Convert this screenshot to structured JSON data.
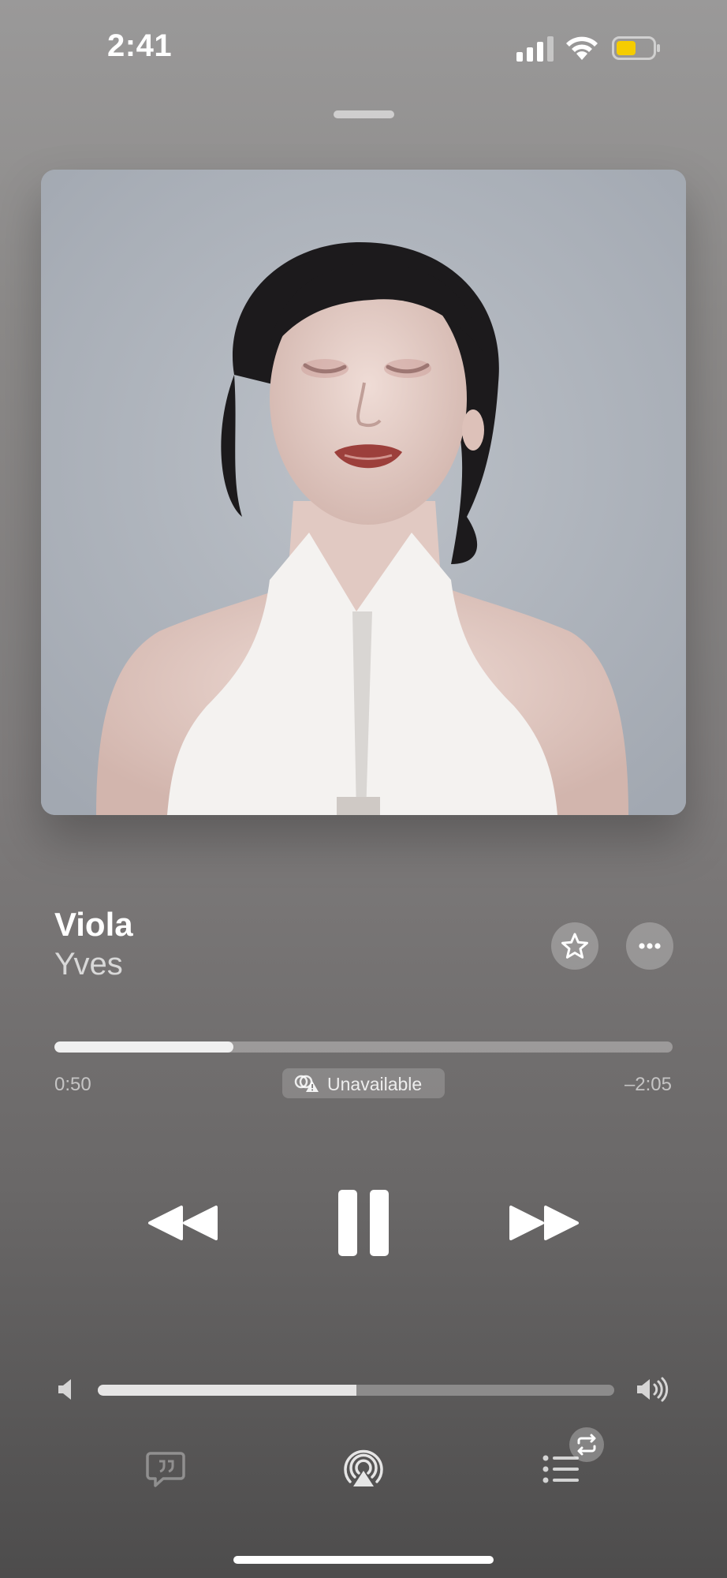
{
  "status_bar": {
    "time": "2:41",
    "icons": [
      "cellular-signal-icon",
      "wifi-icon",
      "battery-icon"
    ],
    "battery_color": "#f5cc00"
  },
  "now_playing": {
    "title": "Viola",
    "artist": "Yves",
    "elapsed": "0:50",
    "remaining": "–2:05",
    "progress_fraction": 0.289,
    "availability_label": "Unavailable",
    "volume_fraction": 0.5
  },
  "actions": {
    "favorite_icon": "star-icon",
    "more_icon": "ellipsis-icon"
  },
  "transport": {
    "previous_icon": "rewind-icon",
    "play_pause_icon": "pause-icon",
    "next_icon": "fast-forward-icon"
  },
  "bottom_bar": {
    "items": [
      "lyrics-icon",
      "airplay-icon",
      "queue-icon"
    ],
    "repeat_badge_icon": "repeat-icon"
  },
  "colors": {
    "background_top": "#9a9999",
    "background_bottom": "#4d4c4c",
    "artwork_backdrop": "#aeb3bb"
  }
}
